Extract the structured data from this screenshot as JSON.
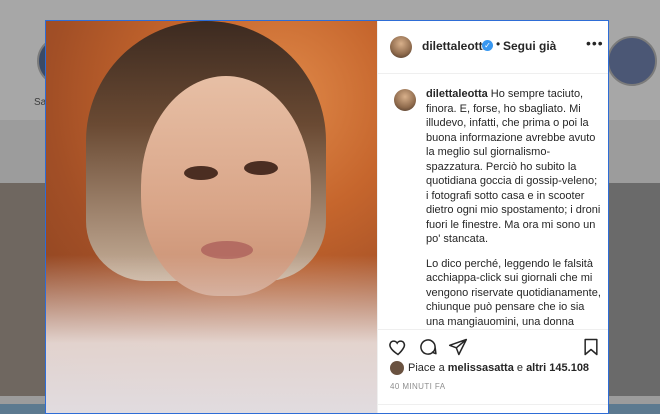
{
  "background": {
    "left_label": "Sa",
    "right_label": "✓"
  },
  "post": {
    "username": "dilettaleotta",
    "follow_status": "Segui già",
    "caption_paragraph_1": "Ho sempre taciuto, finora. E, forse, ho sbagliato. Mi illudevo, infatti, che prima o poi la buona informazione avrebbe avuto la meglio sul giornalismo-spazzatura. Perciò ho subito la quotidiana goccia di gossip-veleno; i fotografi sotto casa e in scooter dietro ogni mio spostamento; i droni fuori le finestre. Ma ora mi sono un po' stancata.",
    "caption_paragraph_2": "Lo dico perché, leggendo le falsità acchiappa-click sui giornali che mi vengono riservate quotidianamente, chiunque può pensare che io sia una mangiauomini, una donna incapace di amare. Ed è inaccettabile. Non mi si venga a raccontare, infatti, che è il prezzo da pagare al successo. O che me la sono cercata e me la cerco per via",
    "likes_prefix": "Piace a",
    "likes_user": "melissasatta",
    "likes_middle": "e",
    "likes_count": "altri 145.108",
    "time_ago": "40 MINUTI FA"
  },
  "colors": {
    "verified": "#3897f0",
    "modal_border": "#2e6dd6"
  },
  "icons": [
    "heart-icon",
    "comment-icon",
    "share-icon",
    "bookmark-icon",
    "more-options-icon",
    "verified-badge-icon"
  ]
}
